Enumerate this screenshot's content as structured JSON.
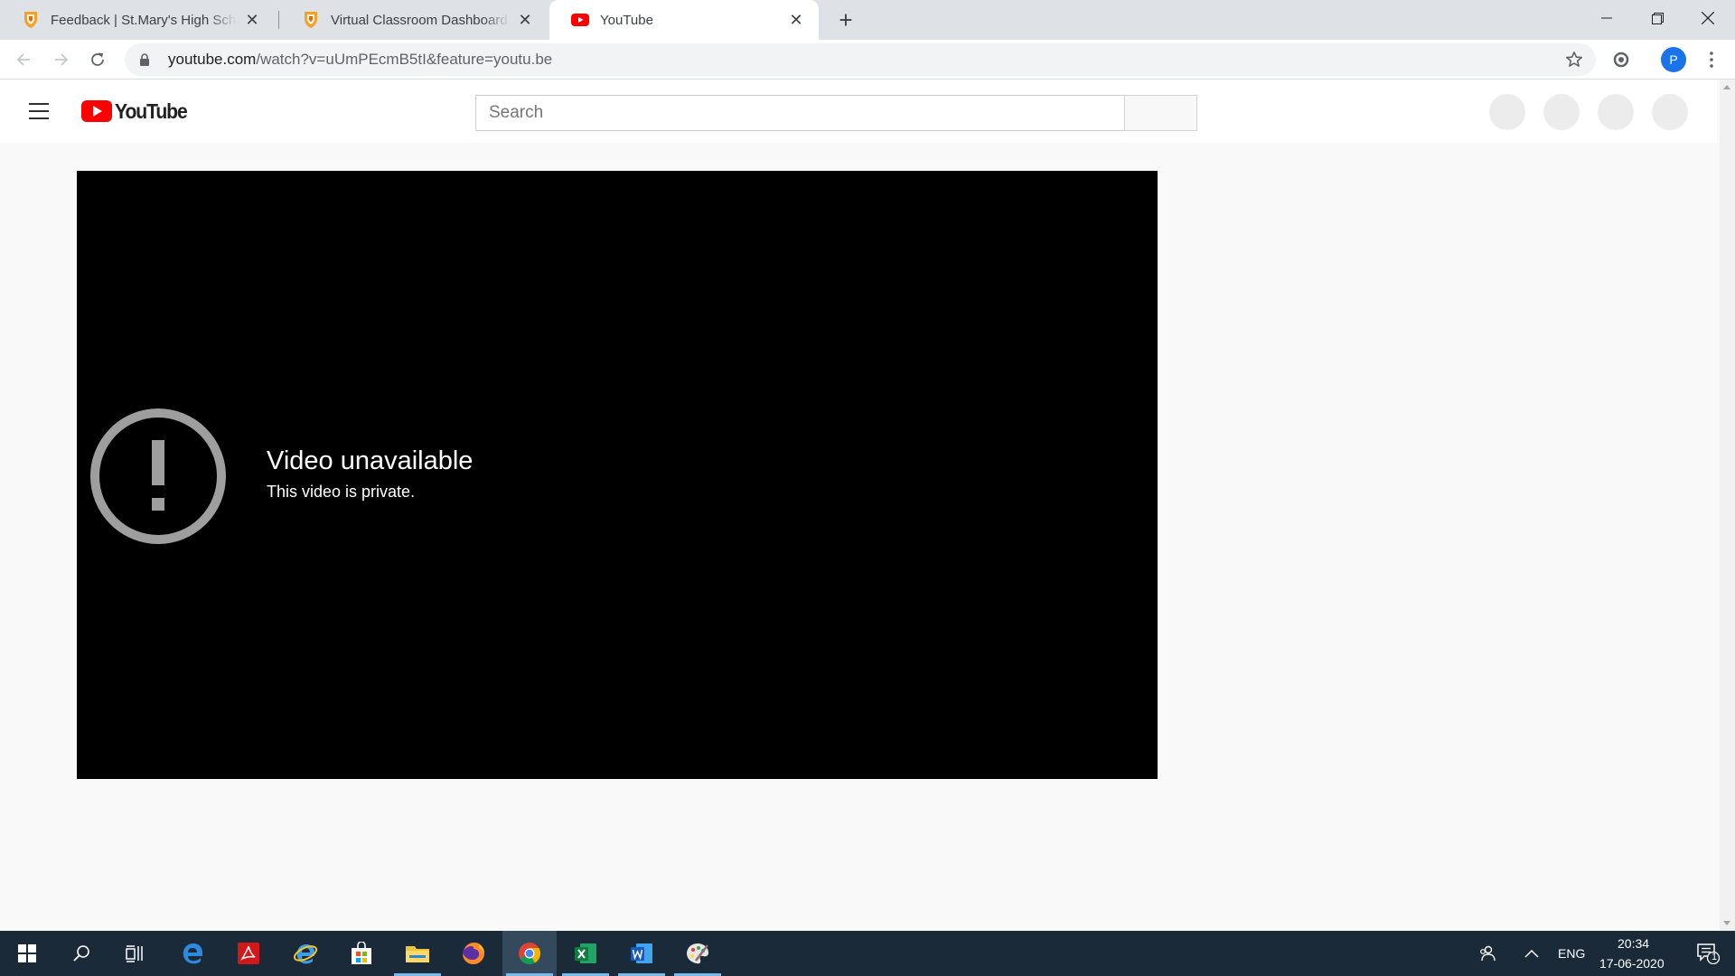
{
  "browser": {
    "tabs": [
      {
        "title": "Feedback | St.Mary's High School",
        "favicon": "shield-favicon",
        "close": "✕"
      },
      {
        "title": "Virtual Classroom Dashboard | St.Mary's High School",
        "favicon": "shield-favicon",
        "close": "✕"
      },
      {
        "title": "YouTube",
        "favicon": "youtube-favicon",
        "close": "✕"
      }
    ],
    "new_tab": "+",
    "url_host": "youtube.com",
    "url_rest": "/watch?v=uUmPEcmB5tI&feature=youtu.be",
    "profile_initial": "P"
  },
  "youtube": {
    "logo_text": "YouTube",
    "search_placeholder": "Search"
  },
  "player": {
    "error_title": "Video unavailable",
    "error_message": "This video is private."
  },
  "taskbar": {
    "language": "ENG",
    "time": "20:34",
    "date": "17-06-2020",
    "notification_count": "1"
  },
  "colors": {
    "youtube_red": "#ff0000",
    "taskbar_bg": "#1b2a38",
    "profile_blue": "#1a73e8"
  }
}
